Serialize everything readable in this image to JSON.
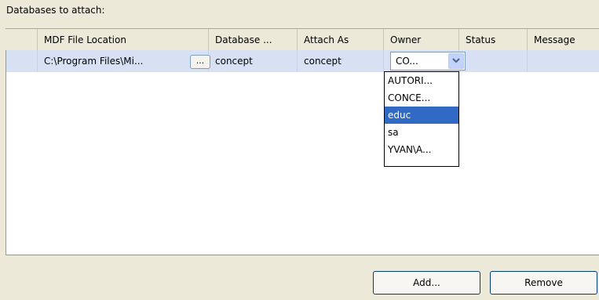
{
  "section_label": "Databases to attach:",
  "columns": [
    "MDF File Location",
    "Database ...",
    "Attach As",
    "Owner",
    "Status",
    "Message"
  ],
  "row": {
    "mdf_file_location": "C:\\Program Files\\Mi...",
    "browse_label": "...",
    "database": "concept",
    "attach_as": "concept",
    "owner": "CO..."
  },
  "owner_options": [
    "AUTORI...",
    "CONCE...",
    "educ",
    "sa",
    "YVAN\\A..."
  ],
  "owner_highlighted": "educ",
  "buttons": {
    "add": "Add...",
    "remove": "Remove"
  },
  "colors": {
    "selection": "#316ac5",
    "row_highlight": "#d8e1f3",
    "background": "#ece9d8"
  }
}
